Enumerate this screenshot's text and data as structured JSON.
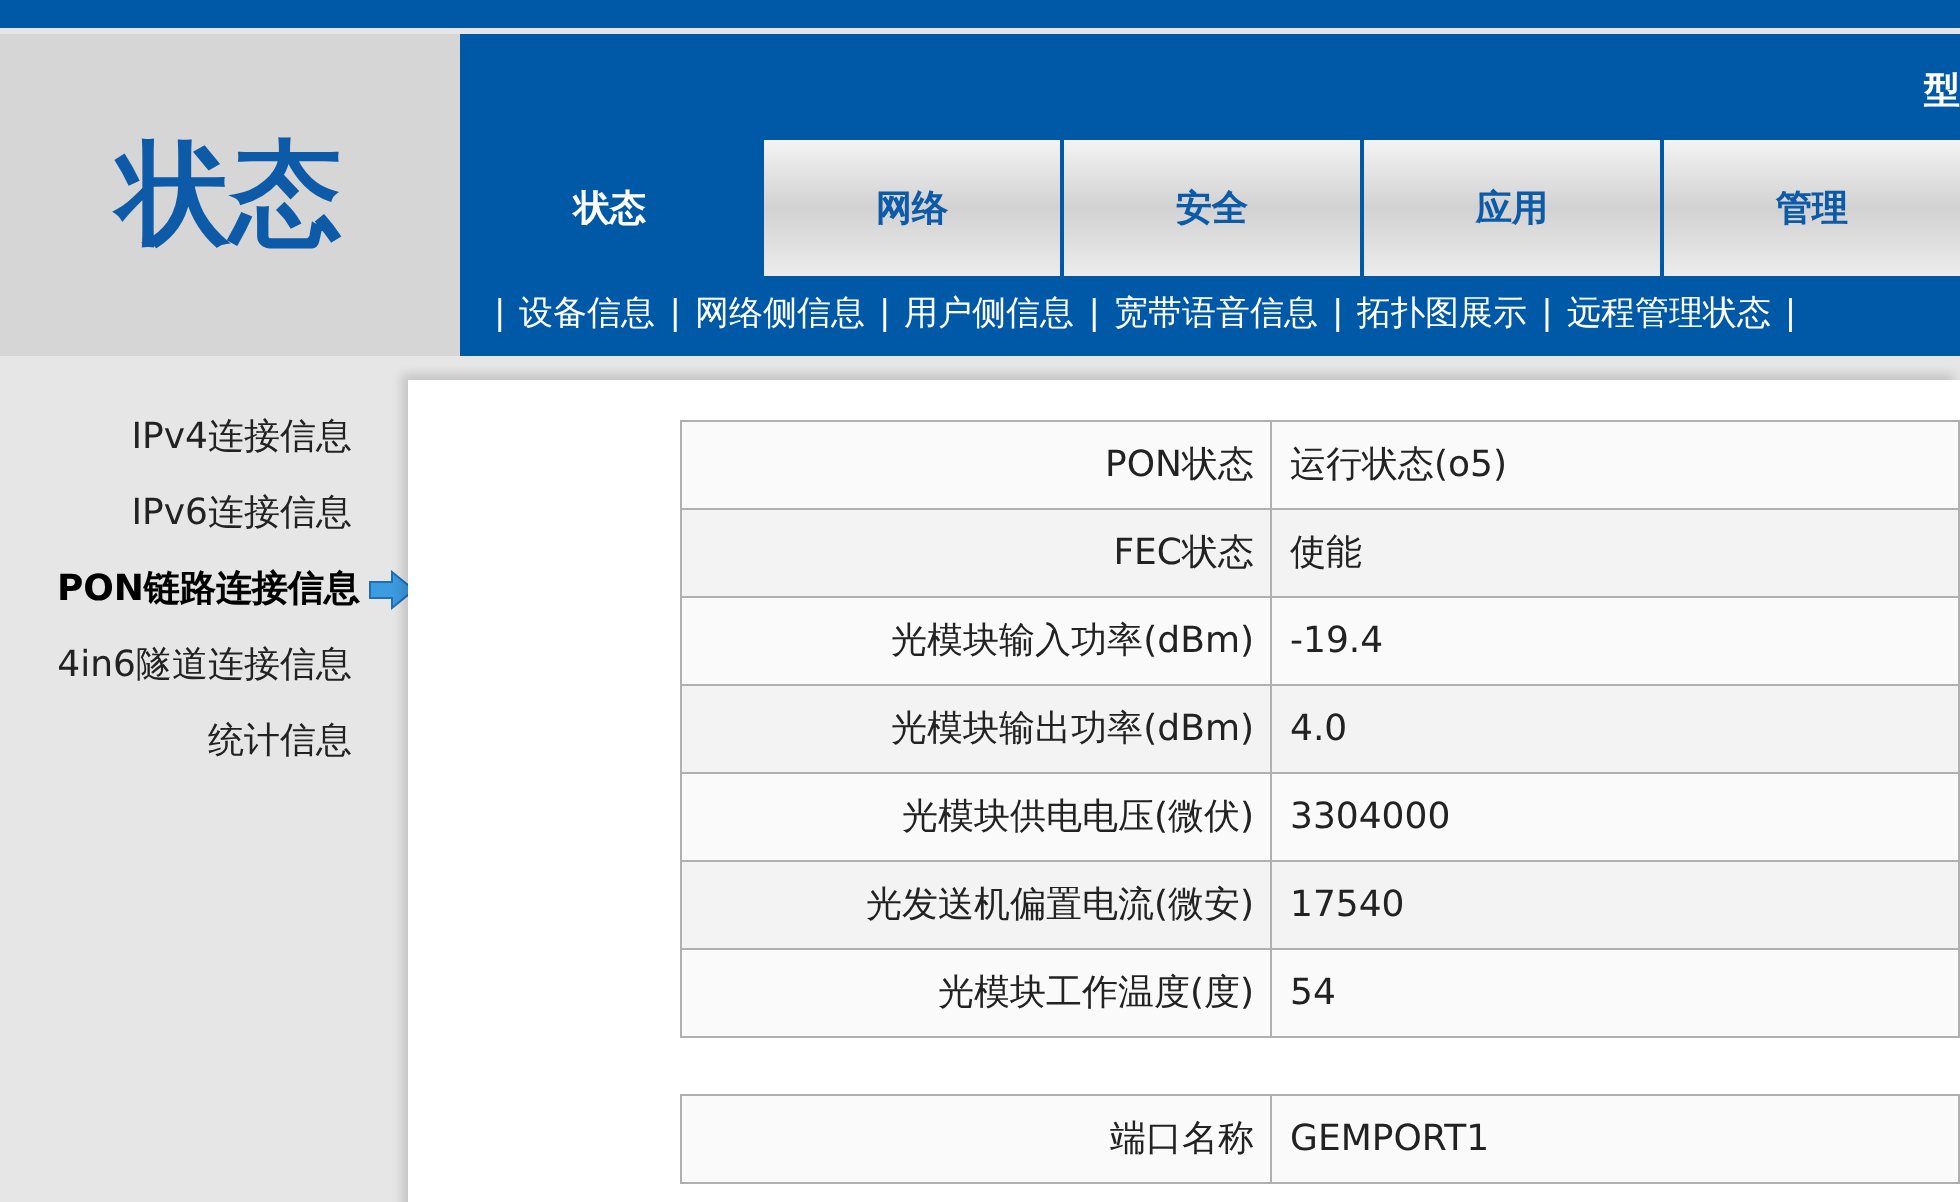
{
  "header": {
    "page_title": "状态",
    "model_label": "型"
  },
  "tabs": [
    {
      "label": "状态",
      "selected": true
    },
    {
      "label": "网络",
      "selected": false
    },
    {
      "label": "安全",
      "selected": false
    },
    {
      "label": "应用",
      "selected": false
    },
    {
      "label": "管理",
      "selected": false
    }
  ],
  "submenu_separator": "|",
  "submenu": [
    "设备信息",
    "网络侧信息",
    "用户侧信息",
    "宽带语音信息",
    "拓扑图展示",
    "远程管理状态"
  ],
  "sidebar": {
    "items": [
      {
        "label": "IPv4连接信息",
        "selected": false
      },
      {
        "label": "IPv6连接信息",
        "selected": false
      },
      {
        "label": "PON链路连接信息",
        "selected": true
      },
      {
        "label": "4in6隧道连接信息",
        "selected": false
      },
      {
        "label": "统计信息",
        "selected": false
      }
    ]
  },
  "tables": [
    {
      "rows": [
        {
          "label": "PON状态",
          "value": "运行状态(o5)"
        },
        {
          "label": "FEC状态",
          "value": "使能"
        },
        {
          "label": "光模块输入功率(dBm)",
          "value": "-19.4"
        },
        {
          "label": "光模块输出功率(dBm)",
          "value": "4.0"
        },
        {
          "label": "光模块供电电压(微伏)",
          "value": "3304000"
        },
        {
          "label": "光发送机偏置电流(微安)",
          "value": "17540"
        },
        {
          "label": "光模块工作温度(度)",
          "value": "54"
        }
      ]
    },
    {
      "rows": [
        {
          "label": "端口名称",
          "value": "GEMPORT1"
        }
      ]
    }
  ]
}
